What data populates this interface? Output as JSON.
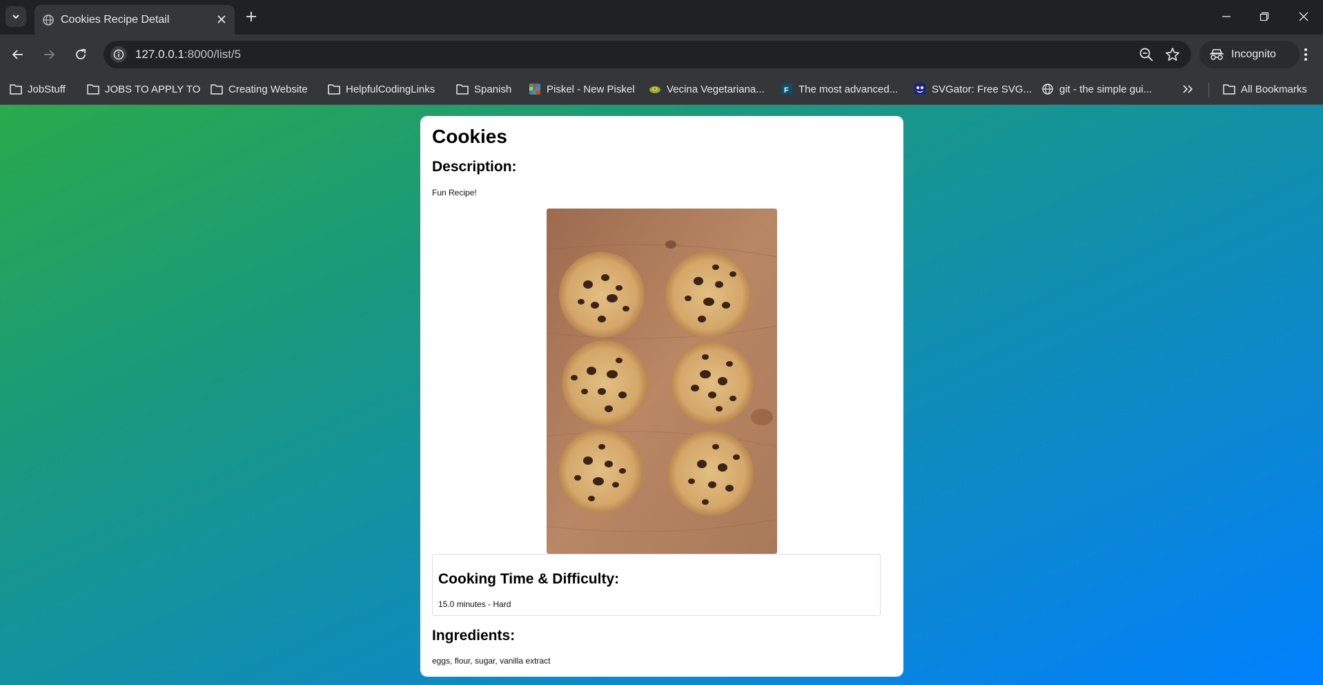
{
  "browser": {
    "tab_title": "Cookies Recipe Detail",
    "url_host": "127.0.0.1",
    "url_path": ":8000/list/5",
    "profile_label": "Incognito"
  },
  "bookmarks": {
    "items": [
      {
        "label": "JobStuff",
        "icon": "folder-icon"
      },
      {
        "label": "JOBS TO APPLY TO",
        "icon": "folder-icon"
      },
      {
        "label": "Creating Website",
        "icon": "folder-icon"
      },
      {
        "label": "HelpfulCodingLinks",
        "icon": "folder-icon"
      },
      {
        "label": "Spanish",
        "icon": "folder-icon"
      },
      {
        "label": "Piskel - New Piskel",
        "icon": "piskel-icon"
      },
      {
        "label": "Vecina Vegetariana...",
        "icon": "vecina-icon"
      },
      {
        "label": "The most advanced...",
        "icon": "f-icon"
      },
      {
        "label": "SVGator: Free SVG...",
        "icon": "svgator-icon"
      },
      {
        "label": "git - the simple gui...",
        "icon": "globe-icon"
      }
    ],
    "all_bookmarks_label": "All Bookmarks"
  },
  "recipe": {
    "title": "Cookies",
    "description_heading": "Description:",
    "description": "Fun Recipe!",
    "time_heading": "Cooking Time & Difficulty:",
    "time_value": "15.0 minutes - Hard",
    "ingredients_heading": "Ingredients:",
    "ingredients": "eggs, flour, sugar, vanilla extract"
  },
  "colors": {
    "page_gradient_start": "#2aaa4b",
    "page_gradient_end": "#0080ff"
  }
}
